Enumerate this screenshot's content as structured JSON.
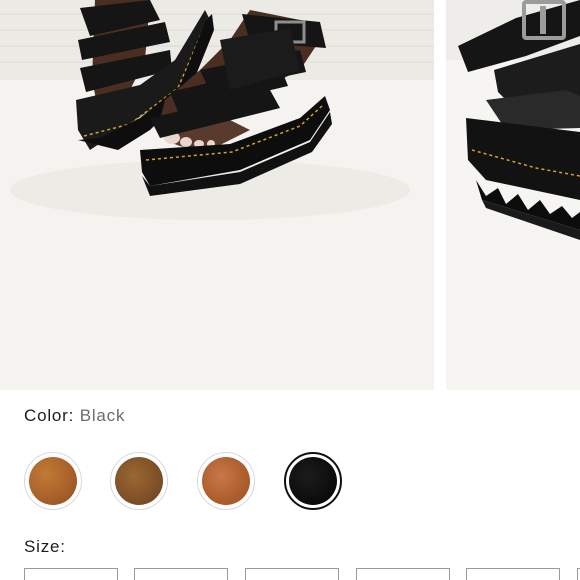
{
  "product": {
    "images": [
      {
        "name": "sandal-on-foot-photo"
      },
      {
        "name": "sandal-closeup-photo"
      }
    ]
  },
  "color": {
    "label": "Color:",
    "selected_value": "Black",
    "swatches": [
      {
        "name": "tan-leather",
        "color": "#b0692b"
      },
      {
        "name": "brown-leather",
        "color": "#8a5a2c"
      },
      {
        "name": "orange-tan-leather",
        "color": "#b8673a"
      },
      {
        "name": "black",
        "color": "#0a0a0a",
        "selected": true
      }
    ]
  },
  "size": {
    "label": "Size:"
  },
  "colors": {
    "text": "#1e1e1e",
    "value_text": "#6b6b6b",
    "selected_ring": "#111111"
  }
}
